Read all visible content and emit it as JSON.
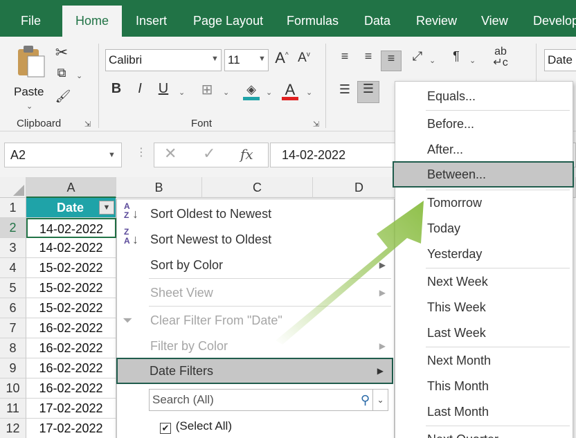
{
  "tabs": [
    "File",
    "Home",
    "Insert",
    "Page Layout",
    "Formulas",
    "Data",
    "Review",
    "View",
    "Develop"
  ],
  "ribbon": {
    "paste_label": "Paste",
    "clipboard_label": "Clipboard",
    "font_name": "Calibri",
    "font_size": "11",
    "font_label": "Font",
    "number_format": "Date"
  },
  "formula_bar": {
    "name_box": "A2",
    "formula_value": "14-02-2022",
    "fx": "fx"
  },
  "columns": [
    "A",
    "B",
    "C",
    "D"
  ],
  "rows": [
    "1",
    "2",
    "3",
    "4",
    "5",
    "6",
    "7",
    "8",
    "9",
    "10",
    "11",
    "12"
  ],
  "header_cell": "Date",
  "dates": [
    "14-02-2022",
    "14-02-2022",
    "15-02-2022",
    "15-02-2022",
    "15-02-2022",
    "16-02-2022",
    "16-02-2022",
    "16-02-2022",
    "16-02-2022",
    "17-02-2022",
    "17-02-2022"
  ],
  "filter_menu": {
    "sort_oldest": "Sort Oldest to Newest",
    "sort_newest": "Sort Newest to Oldest",
    "sort_color": "Sort by Color",
    "sheet_view": "Sheet View",
    "clear_filter": "Clear Filter From \"Date\"",
    "filter_color": "Filter by Color",
    "date_filters": "Date Filters",
    "search_placeholder": "Search (All)",
    "select_all": "(Select All)"
  },
  "date_submenu": [
    "Equals...",
    "Before...",
    "After...",
    "Between...",
    "Tomorrow",
    "Today",
    "Yesterday",
    "Next Week",
    "This Week",
    "Last Week",
    "Next Month",
    "This Month",
    "Last Month",
    "Next Quarter"
  ],
  "colors": {
    "excel_green": "#217346",
    "table_header": "#1fa3a8",
    "highlight": "#c6c6c6",
    "arrow": "#8fc04a"
  }
}
